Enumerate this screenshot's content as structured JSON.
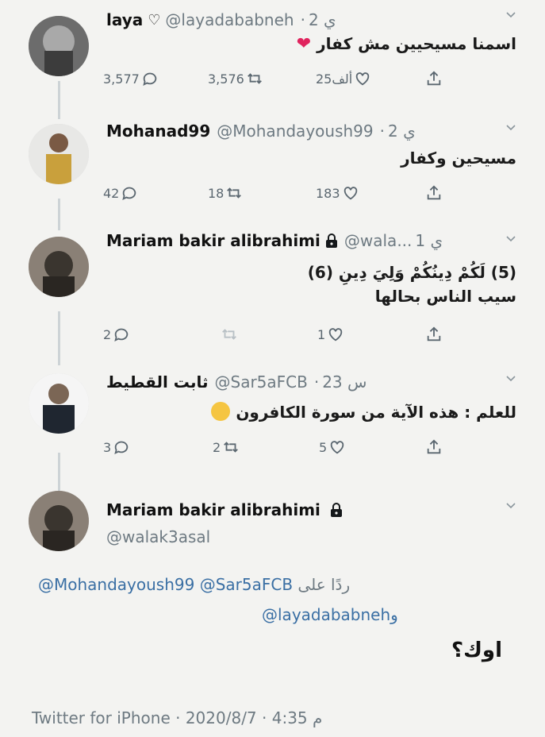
{
  "tweets": [
    {
      "name": "laya",
      "handle": "@layadababneh",
      "time": "2 ي",
      "text": "اسمنا مسيحيين مش كفار",
      "replies": "3,577",
      "retweets": "3,576",
      "likes": "25ألف"
    },
    {
      "name": "Mohanad99",
      "handle": "@Mohandayoush99",
      "time": "2 ي",
      "text": "مسيحين وكفار",
      "replies": "42",
      "retweets": "18",
      "likes": "183"
    },
    {
      "name": "Mariam bakir alibrahimi",
      "handle": "@wala...",
      "time": "1 ي",
      "text_line1": "(5) لَكُمْ دِينُكُمْ وَلِيَ دِينِ (6)",
      "text_line2": "سيب الناس بحالها",
      "replies": "2",
      "retweets": "",
      "likes": "1"
    },
    {
      "name": "ثابت القطيط",
      "handle": "@Sar5aFCB",
      "time": "23 س",
      "text": "للعلم : هذه الآية من سورة الكافرون",
      "replies": "3",
      "retweets": "2",
      "likes": "5"
    }
  ],
  "detail": {
    "name": "Mariam bakir alibrahimi",
    "handle": "@walak3asal",
    "reply_prefix": "ردًا على",
    "reply_handles_1": "@Mohandayoush99 @Sar5aFCB",
    "reply_handles_2": "@layadababneh",
    "reply_and": "و",
    "text": "اوك؟",
    "footer": "Twitter for iPhone · 2020/8/7 · م 4:35"
  }
}
